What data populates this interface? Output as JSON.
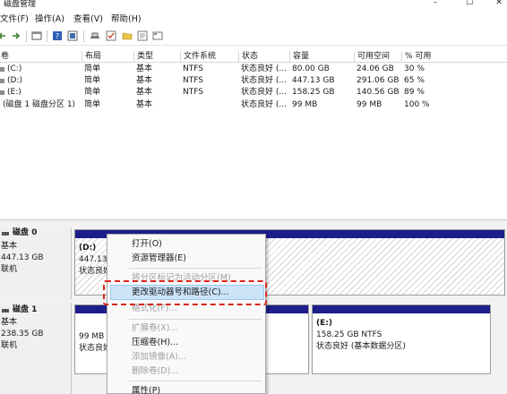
{
  "window": {
    "title": "磁盘管理",
    "controls": [
      "–",
      "☐",
      "✕"
    ]
  },
  "menu": [
    "文件(F)",
    "操作(A)",
    "查看(V)",
    "帮助(H)"
  ],
  "toolbar_icons": [
    "back-icon",
    "forward-icon",
    "properties-icon",
    "help-icon",
    "show-hide-icon",
    "connect-icon",
    "check-icon",
    "folder-icon",
    "search-icon",
    "view-icon"
  ],
  "volume_table": {
    "headers": [
      "卷",
      "布局",
      "类型",
      "文件系统",
      "状态",
      "容量",
      "可用空间",
      "% 可用"
    ],
    "rows": [
      [
        "(C:)",
        "简单",
        "基本",
        "NTFS",
        "状态良好 (...",
        "80.00 GB",
        "24.06 GB",
        "30 %"
      ],
      [
        "(D:)",
        "简单",
        "基本",
        "NTFS",
        "状态良好 (...",
        "447.13 GB",
        "291.06 GB",
        "65 %"
      ],
      [
        "(E:)",
        "简单",
        "基本",
        "NTFS",
        "状态良好 (...",
        "158.25 GB",
        "140.56 GB",
        "89 %"
      ],
      [
        "(磁盘 1 磁盘分区 1)",
        "简单",
        "基本",
        "",
        "状态良好 (...",
        "99 MB",
        "99 MB",
        "100 %"
      ]
    ]
  },
  "disks": [
    {
      "label": "磁盘 0",
      "type": "基本",
      "size": "447.13 GB",
      "status": "联机",
      "partitions": [
        {
          "name": "(D:)",
          "line2": "447.13",
          "line3": "状态良好"
        }
      ]
    },
    {
      "label": "磁盘 1",
      "type": "基本",
      "size": "238.35 GB",
      "status": "联机",
      "partitions": [
        {
          "name": "",
          "line2": "99 MB",
          "line3": "状态良好"
        },
        {
          "name": "(E:)",
          "line2": "158.25 GB NTFS",
          "line3": "状态良好 (基本数据分区)"
        }
      ]
    }
  ],
  "context_menu": {
    "items": [
      {
        "label": "打开(O)",
        "enabled": true
      },
      {
        "label": "资源管理器(E)",
        "enabled": true
      },
      {
        "label": "将分区标记为活动分区(M)",
        "enabled": false
      },
      {
        "label": "更改驱动器号和路径(C)...",
        "enabled": true,
        "highlighted": true
      },
      {
        "label": "格式化(F)...",
        "enabled": false
      },
      {
        "label": "扩展卷(X)...",
        "enabled": false
      },
      {
        "label": "压缩卷(H)...",
        "enabled": true
      },
      {
        "label": "添加镜像(A)...",
        "enabled": false
      },
      {
        "label": "删除卷(D)...",
        "enabled": false
      },
      {
        "label": "属性(P)",
        "enabled": true
      }
    ]
  },
  "colors": {
    "partition_bar": "#1e1e8a",
    "highlight": "#cce4f7",
    "annotation_red": "#d9251d"
  }
}
